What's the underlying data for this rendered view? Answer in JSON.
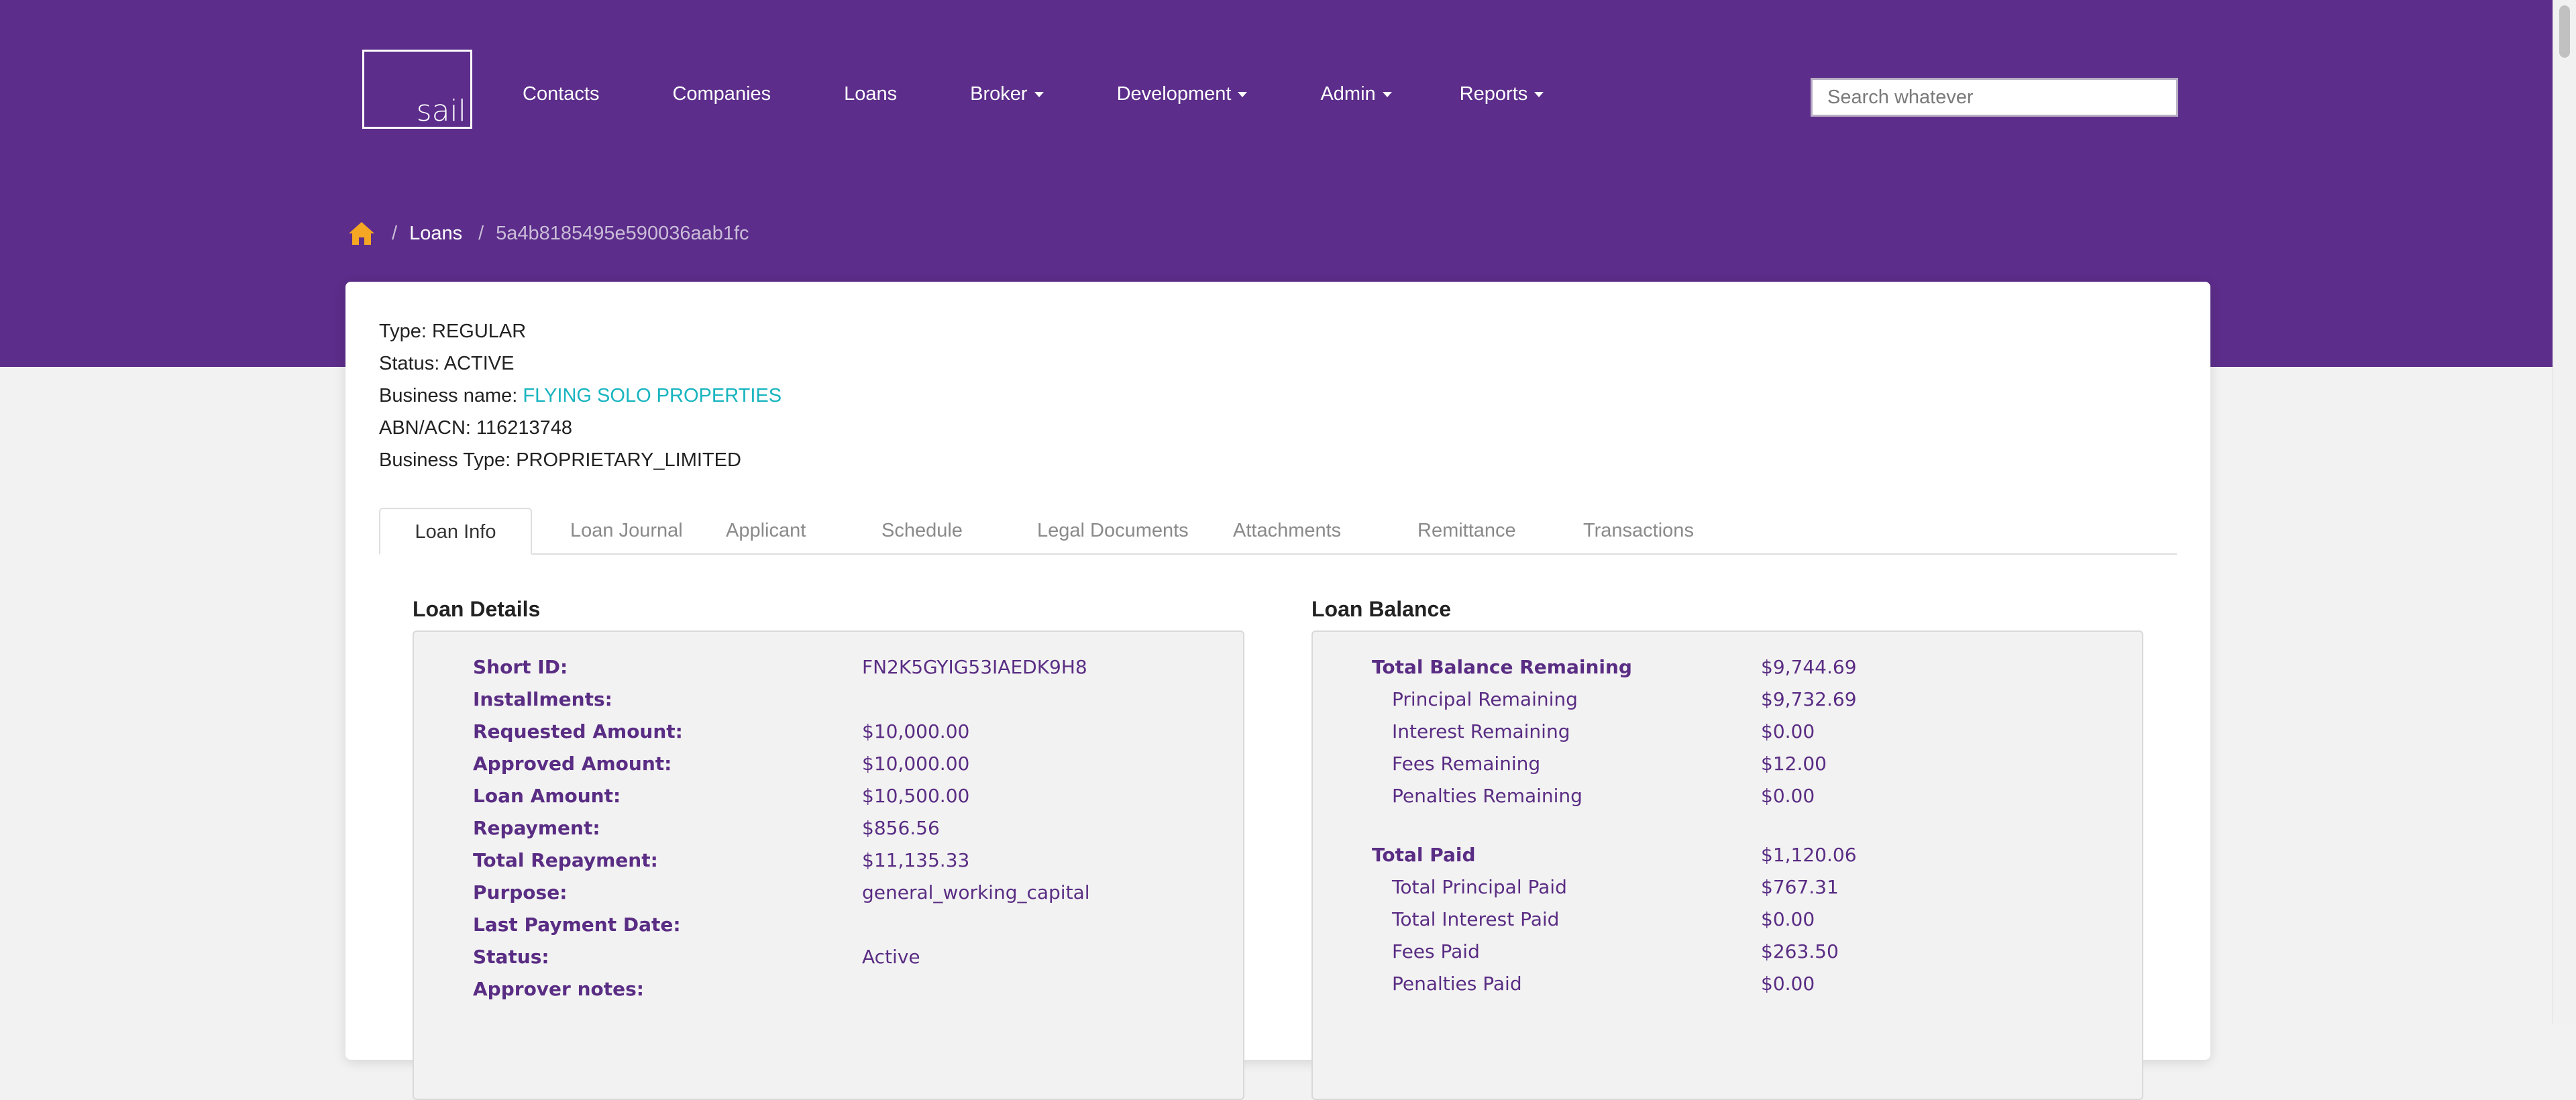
{
  "app": {
    "logo_text": "sail"
  },
  "nav": [
    {
      "label": "Contacts",
      "dropdown": false
    },
    {
      "label": "Companies",
      "dropdown": false
    },
    {
      "label": "Loans",
      "dropdown": false
    },
    {
      "label": "Broker",
      "dropdown": true
    },
    {
      "label": "Development",
      "dropdown": true
    },
    {
      "label": "Admin",
      "dropdown": true
    },
    {
      "label": "Reports",
      "dropdown": true
    }
  ],
  "search": {
    "placeholder": "Search whatever",
    "value": ""
  },
  "breadcrumb": {
    "home_icon": "home-icon",
    "separator": "/",
    "loans": "Loans",
    "current": "5a4b8185495e590036aab1fc"
  },
  "loan_summary": {
    "type_label": "Type:",
    "type_value": "REGULAR",
    "status_label": "Status:",
    "status_value": "ACTIVE",
    "business_name_label": "Business name:",
    "business_name_value": "FLYING SOLO PROPERTIES",
    "abn_label": "ABN/ACN:",
    "abn_value": "116213748",
    "business_type_label": "Business Type:",
    "business_type_value": "PROPRIETARY_LIMITED"
  },
  "tabs": [
    "Loan Info",
    "Loan Journal",
    "Applicant",
    "Schedule",
    "Legal Documents",
    "Attachments",
    "Remittance",
    "Transactions"
  ],
  "active_tab": "Loan Info",
  "loan_details": {
    "title": "Loan Details",
    "rows": [
      {
        "label": "Short ID:",
        "value": "FN2K5GYIG53IAEDK9H8"
      },
      {
        "label": "Installments:",
        "value": ""
      },
      {
        "label": "Requested Amount:",
        "value": "$10,000.00"
      },
      {
        "label": "Approved Amount:",
        "value": "$10,000.00"
      },
      {
        "label": "Loan Amount:",
        "value": "$10,500.00"
      },
      {
        "label": "Repayment:",
        "value": "$856.56"
      },
      {
        "label": "Total Repayment:",
        "value": "$11,135.33"
      },
      {
        "label": "Purpose:",
        "value": "general_working_capital"
      },
      {
        "label": "Last Payment Date:",
        "value": ""
      },
      {
        "label": "Status:",
        "value": "Active"
      },
      {
        "label": "Approver notes:",
        "value": ""
      }
    ]
  },
  "loan_balance": {
    "title": "Loan Balance",
    "remaining_total": {
      "label": "Total Balance Remaining",
      "value": "$9,744.69"
    },
    "remaining_items": [
      {
        "label": "Principal Remaining",
        "value": "$9,732.69"
      },
      {
        "label": "Interest Remaining",
        "value": "$0.00"
      },
      {
        "label": "Fees Remaining",
        "value": "$12.00"
      },
      {
        "label": "Penalties Remaining",
        "value": "$0.00"
      }
    ],
    "paid_total": {
      "label": "Total Paid",
      "value": "$1,120.06"
    },
    "paid_items": [
      {
        "label": "Total Principal Paid",
        "value": "$767.31"
      },
      {
        "label": "Total Interest Paid",
        "value": "$0.00"
      },
      {
        "label": "Fees Paid",
        "value": "$263.50"
      },
      {
        "label": "Penalties Paid",
        "value": "$0.00"
      }
    ]
  },
  "colors": {
    "header_bg": "#5c2d8a",
    "accent_link": "#17b4bf",
    "home_icon": "#f5a623",
    "label_text": "#5a2d84"
  }
}
